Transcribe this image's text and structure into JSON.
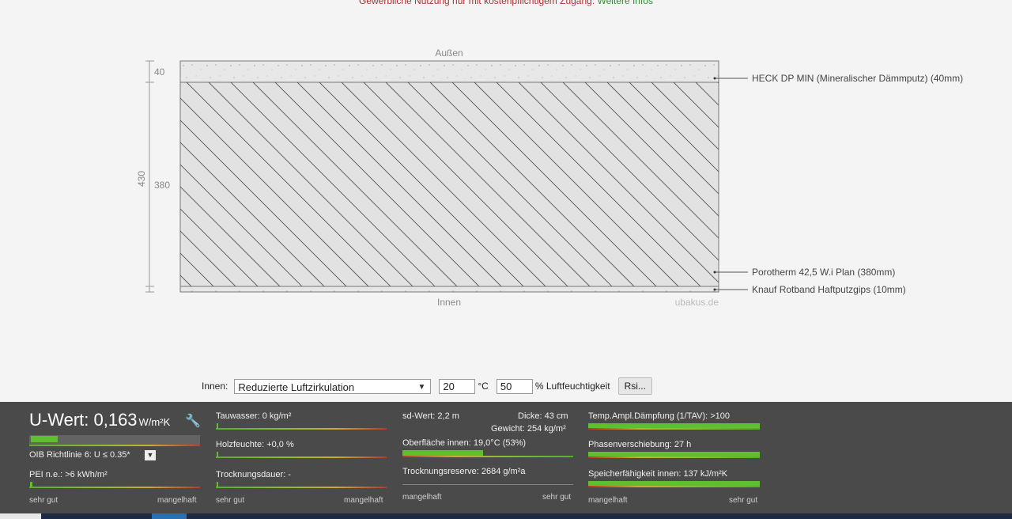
{
  "notice": {
    "text": "Gewerbliche Nutzung nur mit kostenpflichtigem Zugang.",
    "link": "Weitere Infos"
  },
  "diagram": {
    "outside_label": "Außen",
    "inside_label": "Innen",
    "watermark": "ubakus.de",
    "total_thickness": "430",
    "layer_thicknesses": [
      "40",
      "380"
    ],
    "layers": [
      "HECK DP MIN (Mineralischer Dämmputz) (40mm)",
      "Porotherm 42,5 W.i Plan (380mm)",
      "Knauf Rotband Haftputzgips (10mm)"
    ]
  },
  "controls": {
    "inside_label": "Innen:",
    "climate": "Reduzierte Luftzirkulation",
    "temperature": "20",
    "temperature_unit": "°C",
    "humidity": "50",
    "humidity_unit": "% Luftfeuchtigkeit",
    "rsi_button": "Rsi..."
  },
  "results": {
    "uwert_label": "U-Wert: 0,163",
    "uwert_unit": "W/m²K",
    "oib": "OIB Richtlinie 6: U ≤ 0.35*",
    "pei": "PEI n.e.: >6 kWh/m²",
    "col1_left": "sehr gut",
    "col1_right": "mangelhaft",
    "tauwasser": "Tauwasser: 0 kg/m²",
    "holzfeuchte": "Holzfeuchte: +0,0 %",
    "trocknungsdauer": "Trocknungsdauer: -",
    "col2_left": "sehr gut",
    "col2_right": "mangelhaft",
    "sd_wert": "sd-Wert: 2,2 m",
    "dicke": "Dicke: 43 cm",
    "gewicht": "Gewicht: 254 kg/m²",
    "oberflaeche": "Oberfläche innen: 19,0°C (53%)",
    "trocknungsreserve": "Trocknungsreserve: 2684 g/m²a",
    "col3_left": "mangelhaft",
    "col3_right": "sehr gut",
    "tav": "Temp.Ampl.Dämpfung (1/TAV): >100",
    "phasen": "Phasenverschiebung: 27 h",
    "speicher": "Speicherfähigkeit innen: 137 kJ/m²K",
    "col4_left": "mangelhaft",
    "col4_right": "sehr gut"
  },
  "colors": {
    "panel": "#4a4a4a",
    "good": "#5fbf2f",
    "bad": "#c0392b",
    "notice": "#b03030",
    "link": "#2f8f2f"
  }
}
